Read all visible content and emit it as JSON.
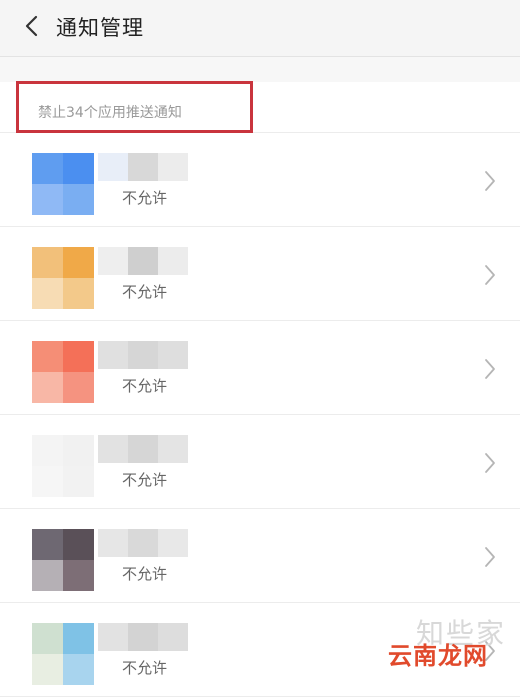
{
  "header": {
    "back_icon": "chevron-left-icon",
    "title": "通知管理"
  },
  "summary": {
    "text": "禁止34个应用推送通知"
  },
  "apps": [
    {
      "status": "不允许",
      "icon_colors": [
        "#5f9df0",
        "#4b8ff0",
        "#8fb9f5",
        "#7aaef2"
      ],
      "name_colors": [
        "#e8eef8",
        "#d8d8d8",
        "#ececec"
      ]
    },
    {
      "status": "不允许",
      "icon_colors": [
        "#f2c07a",
        "#f0a948",
        "#f7dcb4",
        "#f3c98a"
      ],
      "name_colors": [
        "#eeeeee",
        "#cfcfcf",
        "#ececec"
      ]
    },
    {
      "status": "不允许",
      "icon_colors": [
        "#f58e76",
        "#f47058",
        "#f8b7a6",
        "#f59380"
      ],
      "name_colors": [
        "#e0e0e0",
        "#d6d6d6",
        "#dedede"
      ]
    },
    {
      "status": "不允许",
      "icon_colors": [
        "#f4f4f4",
        "#f1f1f1",
        "#f6f6f6",
        "#f2f2f2"
      ],
      "name_colors": [
        "#e2e2e2",
        "#d6d6d6",
        "#e4e4e4"
      ]
    },
    {
      "status": "不允许",
      "icon_colors": [
        "#6e6872",
        "#5a5058",
        "#b5b0b5",
        "#7d6e76"
      ],
      "name_colors": [
        "#e6e6e6",
        "#d9d9d9",
        "#e8e8e8"
      ]
    },
    {
      "status": "不允许",
      "icon_colors": [
        "#cfe0d0",
        "#7fc2e6",
        "#e8eee2",
        "#a8d4ee"
      ],
      "name_colors": [
        "#e2e2e2",
        "#d3d3d3",
        "#dddddd"
      ]
    }
  ],
  "row_chevron_icon": "chevron-right-icon",
  "watermark": {
    "top_text": "知些家",
    "main_text": "云南龙网"
  },
  "colors": {
    "highlight_border": "#c9343d",
    "header_bg": "#f5f5f5",
    "summary_text": "#9a9a9a",
    "status_text": "#666666",
    "watermark_red": "#e14a2c"
  }
}
